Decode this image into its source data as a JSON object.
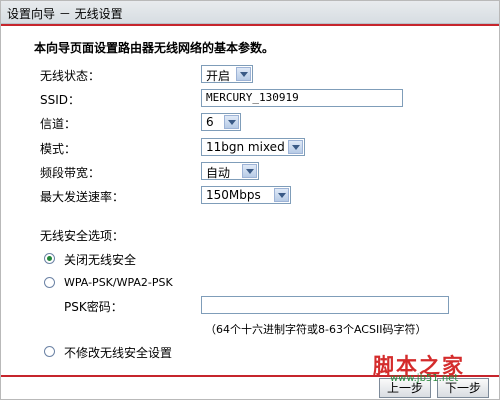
{
  "window": {
    "title": "设置向导 － 无线设置"
  },
  "intro": "本向导页面设置路由器无线网络的基本参数。",
  "fields": {
    "wireless_status": {
      "label": "无线状态：",
      "value": "开启"
    },
    "ssid": {
      "label": "SSID：",
      "value": "MERCURY_130919"
    },
    "channel": {
      "label": "信道：",
      "value": "6"
    },
    "mode": {
      "label": "模式：",
      "value": "11bgn mixed"
    },
    "bandwidth": {
      "label": "频段带宽：",
      "value": "自动"
    },
    "max_rate": {
      "label": "最大发送速率：",
      "value": "150Mbps"
    }
  },
  "security": {
    "heading": "无线安全选项：",
    "options": [
      {
        "label": "关闭无线安全",
        "checked": true
      },
      {
        "label": "WPA-PSK/WPA2-PSK",
        "checked": false
      },
      {
        "label": "不修改无线安全设置",
        "checked": false
      }
    ],
    "psk_label": "PSK密码：",
    "psk_value": "",
    "psk_note": "（64个十六进制字符或8-63个ACSII码字符）"
  },
  "buttons": {
    "prev": "上一步",
    "next": "下一步"
  },
  "watermark": {
    "text": "脚本之家",
    "url": "www.jb51.net"
  },
  "colors": {
    "accent_line": "#c6252c",
    "title_bg": "#dfe4e9"
  }
}
